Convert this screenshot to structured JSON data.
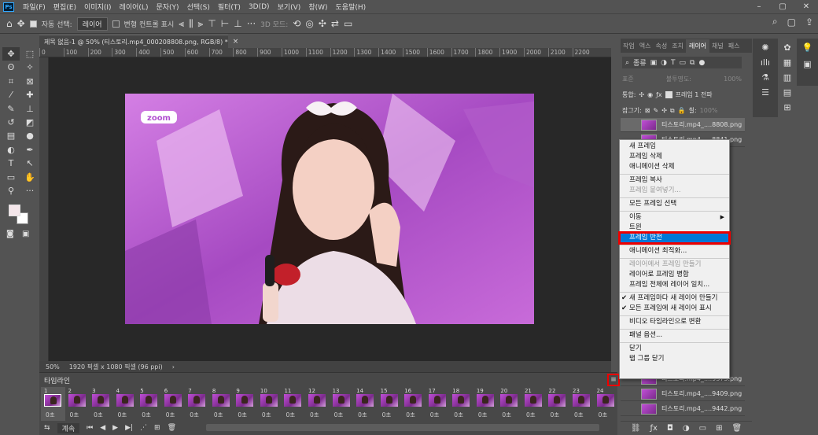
{
  "menubar": {
    "logo": "Ps",
    "items": [
      "파일(F)",
      "편집(E)",
      "이미지(I)",
      "레이어(L)",
      "문자(Y)",
      "선택(S)",
      "필터(T)",
      "3D(D)",
      "보기(V)",
      "창(W)",
      "도움말(H)"
    ]
  },
  "window_controls": {
    "minimize": "–",
    "restore": "▢",
    "close": "✕"
  },
  "options": {
    "auto_select_label": "자동 선택:",
    "auto_select_value": "레이어",
    "transform_label": "변형 컨트롤 표시",
    "mode_3d": "3D 모드:"
  },
  "document": {
    "tab_title": "제목 없음-1 @ 50% (티스토리.mp4_000208808.png, RGB/8) *",
    "close": "×",
    "ruler_ticks": [
      "0",
      "100",
      "200",
      "300",
      "400",
      "500",
      "600",
      "700",
      "800",
      "900",
      "1000",
      "1100",
      "1200",
      "1300",
      "1400",
      "1500",
      "1600",
      "1700",
      "1800",
      "1900",
      "2000",
      "2100",
      "2200"
    ],
    "zoom": "50%",
    "size_info": "1920 픽셀 x 1080 픽셀 (96 ppi)",
    "watermark": "zoom"
  },
  "timeline": {
    "title": "타임라인",
    "menu_icon": "≡",
    "frames": [
      "1",
      "2",
      "3",
      "4",
      "5",
      "6",
      "7",
      "8",
      "9",
      "10",
      "11",
      "12",
      "13",
      "14",
      "15",
      "16",
      "17",
      "18",
      "19",
      "20",
      "21",
      "22",
      "23",
      "24"
    ],
    "delay": "0초",
    "loop": "계속"
  },
  "layers_panel": {
    "tabs": [
      "작업",
      "액스",
      "속성",
      "조치",
      "레이어",
      "채널",
      "패스"
    ],
    "active_tab": "레이어",
    "filter": "종류",
    "blend": "표준",
    "opacity_label": "불투명도:",
    "opacity": "100%",
    "unify_label": "통합:",
    "propagate": "프레임 1 전파",
    "lock_label": "잠그기:",
    "fill_label": "칠:",
    "fill": "100%",
    "layers": [
      "티스토리.mp4_....8808.png",
      "티스토리.mp4_....8841.png",
      "티스토리.mp4_....9375.png",
      "티스토리.mp4_....9409.png",
      "티스토리.mp4_....9442.png"
    ]
  },
  "context_menu": {
    "items": [
      {
        "label": "새 프레임"
      },
      {
        "label": "프레임 삭제"
      },
      {
        "label": "애니메이션 삭제"
      },
      {
        "sep": true
      },
      {
        "label": "프레임 복사"
      },
      {
        "label": "프레임 붙여넣기...",
        "disabled": true
      },
      {
        "sep": true
      },
      {
        "label": "모든 프레임 선택"
      },
      {
        "sep": true
      },
      {
        "label": "이동",
        "submenu": true
      },
      {
        "label": "트윈"
      },
      {
        "label": "프레임 반전",
        "highlight": true
      },
      {
        "sep": true
      },
      {
        "label": "애니메이션 최적화..."
      },
      {
        "sep": true
      },
      {
        "label": "레이어에서 프레임 만들기",
        "disabled": true
      },
      {
        "label": "레이어로 프레임 병합"
      },
      {
        "label": "프레임 전체에 레이어 일치..."
      },
      {
        "sep": true
      },
      {
        "label": "새 프레임마다 새 레이어 만들기",
        "checked": true
      },
      {
        "label": "모든 프레임에 새 레이어 표시",
        "checked": true
      },
      {
        "sep": true
      },
      {
        "label": "비디오 타임라인으로 변환"
      },
      {
        "sep": true
      },
      {
        "label": "패널 옵션..."
      },
      {
        "sep": true
      },
      {
        "label": "닫기"
      },
      {
        "label": "탭 그룹 닫기"
      }
    ]
  },
  "colors": {
    "highlight": "#0078d7",
    "callout": "#ee0000",
    "stage": "#c86bd9"
  }
}
